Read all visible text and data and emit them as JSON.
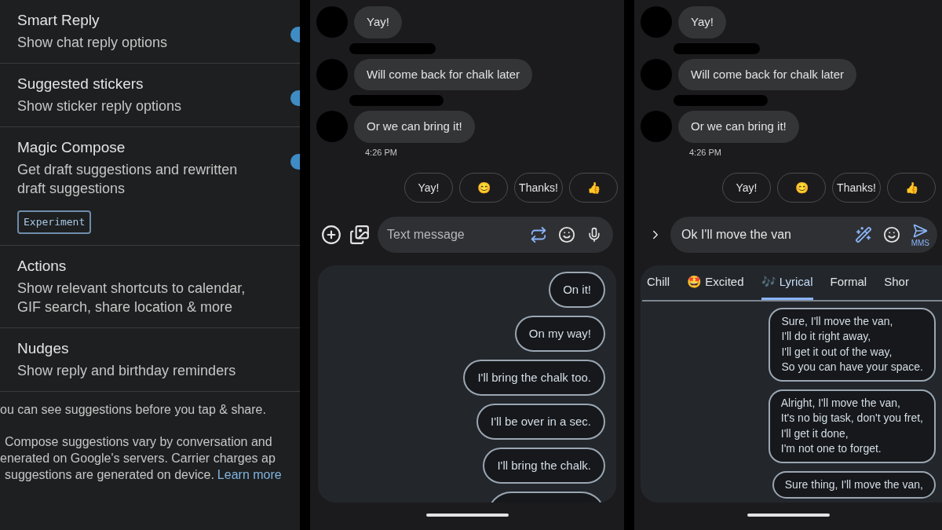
{
  "settings": {
    "items": [
      {
        "title": "Smart Reply",
        "subtitle": "Show chat reply options",
        "on": true
      },
      {
        "title": "Suggested stickers",
        "subtitle": "Show sticker reply options",
        "on": true
      },
      {
        "title": "Magic Compose",
        "subtitle": "Get draft suggestions and rewritten draft suggestions",
        "on": true,
        "badge": "Experiment"
      },
      {
        "title": "Actions",
        "subtitle": "Show relevant shortcuts to calendar, GIF search, share location & more"
      },
      {
        "title": "Nudges",
        "subtitle": "Show reply and birthday reminders"
      }
    ],
    "footnote_lines": [
      "ou can see suggestions before you tap & share.",
      "Compose suggestions vary by conversation and",
      "enerated on Google's servers. Carrier charges ap",
      "suggestions are generated on device."
    ],
    "link": "Learn more"
  },
  "middle_phone": {
    "messages": [
      "Yay!",
      "Will come back for chalk later",
      "Or we can bring it!"
    ],
    "time": "4:26 PM",
    "smart_replies": [
      "Yay!",
      "😊",
      "Thanks!",
      "👍"
    ],
    "compose": {
      "placeholder": "Text message"
    },
    "suggestions": [
      "On it!",
      "On my way!",
      "I'll bring the chalk too.",
      "I'll be over in a sec.",
      "I'll bring the chalk."
    ]
  },
  "right_phone": {
    "messages": [
      "Yay!",
      "Will come back for chalk later",
      "Or we can bring it!"
    ],
    "time": "4:26 PM",
    "smart_replies": [
      "Yay!",
      "😊",
      "Thanks!",
      "👍"
    ],
    "compose": {
      "value": "Ok I'll move the van",
      "send_label": "MMS"
    },
    "tabs": [
      {
        "label": "Chill",
        "selected": false
      },
      {
        "label": "🤩 Excited",
        "selected": false
      },
      {
        "label": "🎶 Lyrical",
        "selected": true
      },
      {
        "label": "Formal",
        "selected": false
      },
      {
        "label": "Shor",
        "selected": false
      }
    ],
    "drafts": [
      [
        "Sure, I'll move the van,",
        "I'll do it right away,",
        "I'll get it out of the way,",
        "So you can have your space."
      ],
      [
        "Alright, I'll move the van,",
        "It's no big task, don't you fret,",
        "I'll get it done,",
        "I'm not one to forget."
      ],
      [
        "Sure thing, I'll move the van,"
      ]
    ]
  }
}
